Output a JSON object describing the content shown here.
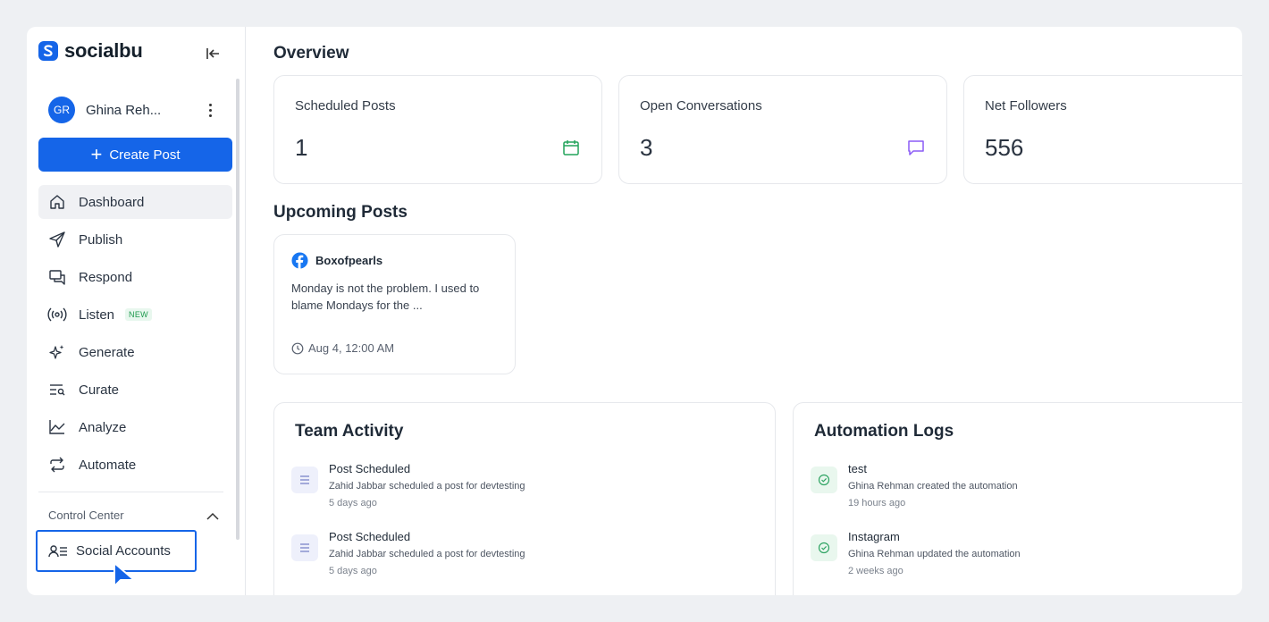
{
  "brand": {
    "name": "socialbu"
  },
  "user": {
    "initials": "GR",
    "name": "Ghina Reh..."
  },
  "sidebar": {
    "create_label": "Create Post",
    "items": [
      {
        "label": "Dashboard",
        "icon": "home-icon"
      },
      {
        "label": "Publish",
        "icon": "send-icon"
      },
      {
        "label": "Respond",
        "icon": "chat-icon"
      },
      {
        "label": "Listen",
        "icon": "broadcast-icon",
        "badge": "NEW"
      },
      {
        "label": "Generate",
        "icon": "sparkle-icon"
      },
      {
        "label": "Curate",
        "icon": "curate-icon"
      },
      {
        "label": "Analyze",
        "icon": "chart-line-icon"
      },
      {
        "label": "Automate",
        "icon": "repeat-icon"
      }
    ],
    "section_title": "Control Center",
    "social_accounts_label": "Social Accounts"
  },
  "overview": {
    "title": "Overview",
    "stats": [
      {
        "title": "Scheduled Posts",
        "value": "1",
        "icon": "calendar-icon",
        "color": "#22a35a"
      },
      {
        "title": "Open Conversations",
        "value": "3",
        "icon": "message-icon",
        "color": "#8b5cf6"
      },
      {
        "title": "Net Followers",
        "value": "556"
      }
    ]
  },
  "upcoming": {
    "title": "Upcoming Posts",
    "post": {
      "account": "Boxofpearls",
      "text": "Monday is not the problem. I used to blame Mondays for the ...",
      "time": "Aug 4, 12:00 AM"
    }
  },
  "team_activity": {
    "title": "Team Activity",
    "items": [
      {
        "title": "Post Scheduled",
        "desc": "Zahid Jabbar scheduled a post for devtesting",
        "time": "5 days ago"
      },
      {
        "title": "Post Scheduled",
        "desc": "Zahid Jabbar scheduled a post for devtesting",
        "time": "5 days ago"
      }
    ]
  },
  "automation_logs": {
    "title": "Automation Logs",
    "items": [
      {
        "title": "test",
        "desc": "Ghina Rehman created the automation",
        "time": "19 hours ago"
      },
      {
        "title": "Instagram",
        "desc": "Ghina Rehman updated the automation",
        "time": "2 weeks ago"
      }
    ]
  },
  "colors": {
    "accent": "#1565e8",
    "facebook": "#1877f2"
  }
}
